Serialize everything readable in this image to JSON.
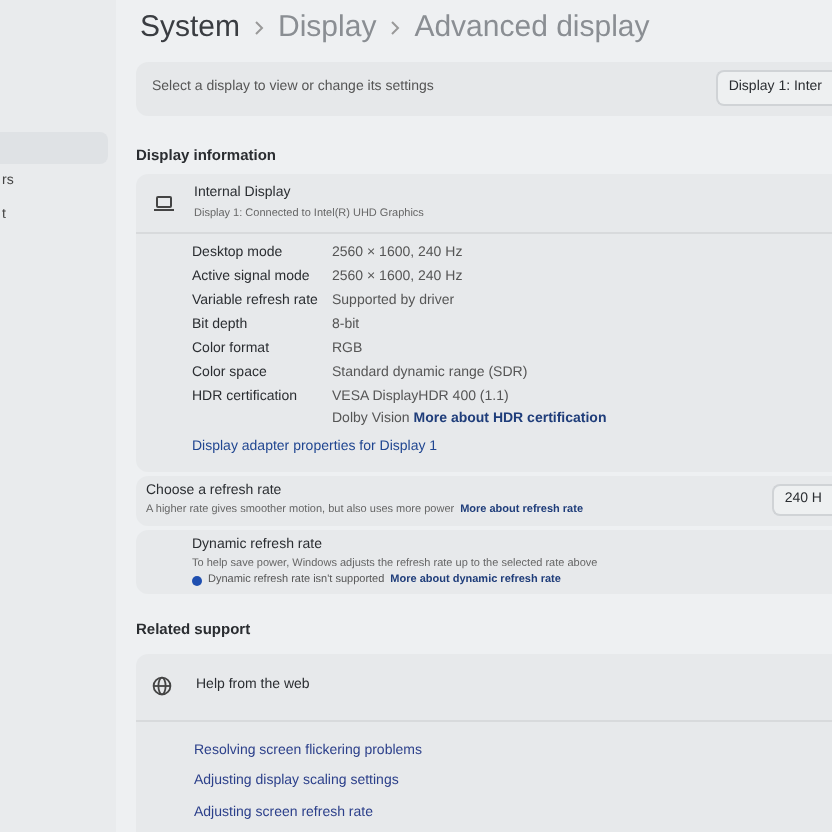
{
  "sidebar": {
    "items": [
      {
        "label": "rs",
        "selected": false
      },
      {
        "label": "t",
        "selected": false
      }
    ],
    "highlight_selected": true
  },
  "breadcrumb": [
    "System",
    "Display",
    "Advanced display"
  ],
  "display_selector": {
    "label": "Select a display to view or change its settings",
    "value": "Display 1: Inter"
  },
  "display_information": {
    "heading": "Display information",
    "device": {
      "title": "Internal Display",
      "subtitle": "Display 1: Connected to Intel(R) UHD Graphics"
    },
    "properties": [
      {
        "label": "Desktop mode",
        "value": "2560 × 1600, 240 Hz"
      },
      {
        "label": "Active signal mode",
        "value": "2560 × 1600, 240 Hz"
      },
      {
        "label": "Variable refresh rate",
        "value": "Supported by driver"
      },
      {
        "label": "Bit depth",
        "value": "8-bit"
      },
      {
        "label": "Color format",
        "value": "RGB"
      },
      {
        "label": "Color space",
        "value": "Standard dynamic range (SDR)"
      },
      {
        "label": "HDR certification",
        "value": "VESA DisplayHDR 400 (1.1)",
        "second_line": "Dolby Vision",
        "second_link": "More about HDR certification"
      }
    ],
    "adapter_link": "Display adapter properties for Display 1"
  },
  "refresh_rate": {
    "title": "Choose a refresh rate",
    "description": "A higher rate gives smoother motion, but also uses more power",
    "link": "More about refresh rate",
    "value": "240 H"
  },
  "dynamic_refresh": {
    "title": "Dynamic refresh rate",
    "description": "To help save power, Windows adjusts the refresh rate up to the selected rate above",
    "notice": "Dynamic refresh rate isn't supported",
    "notice_link": "More about dynamic refresh rate"
  },
  "related_support": {
    "heading": "Related support",
    "help": {
      "title": "Help from the web",
      "expanded": true
    },
    "links": [
      "Resolving screen flickering problems",
      "Adjusting display scaling settings",
      "Adjusting screen refresh rate"
    ]
  }
}
